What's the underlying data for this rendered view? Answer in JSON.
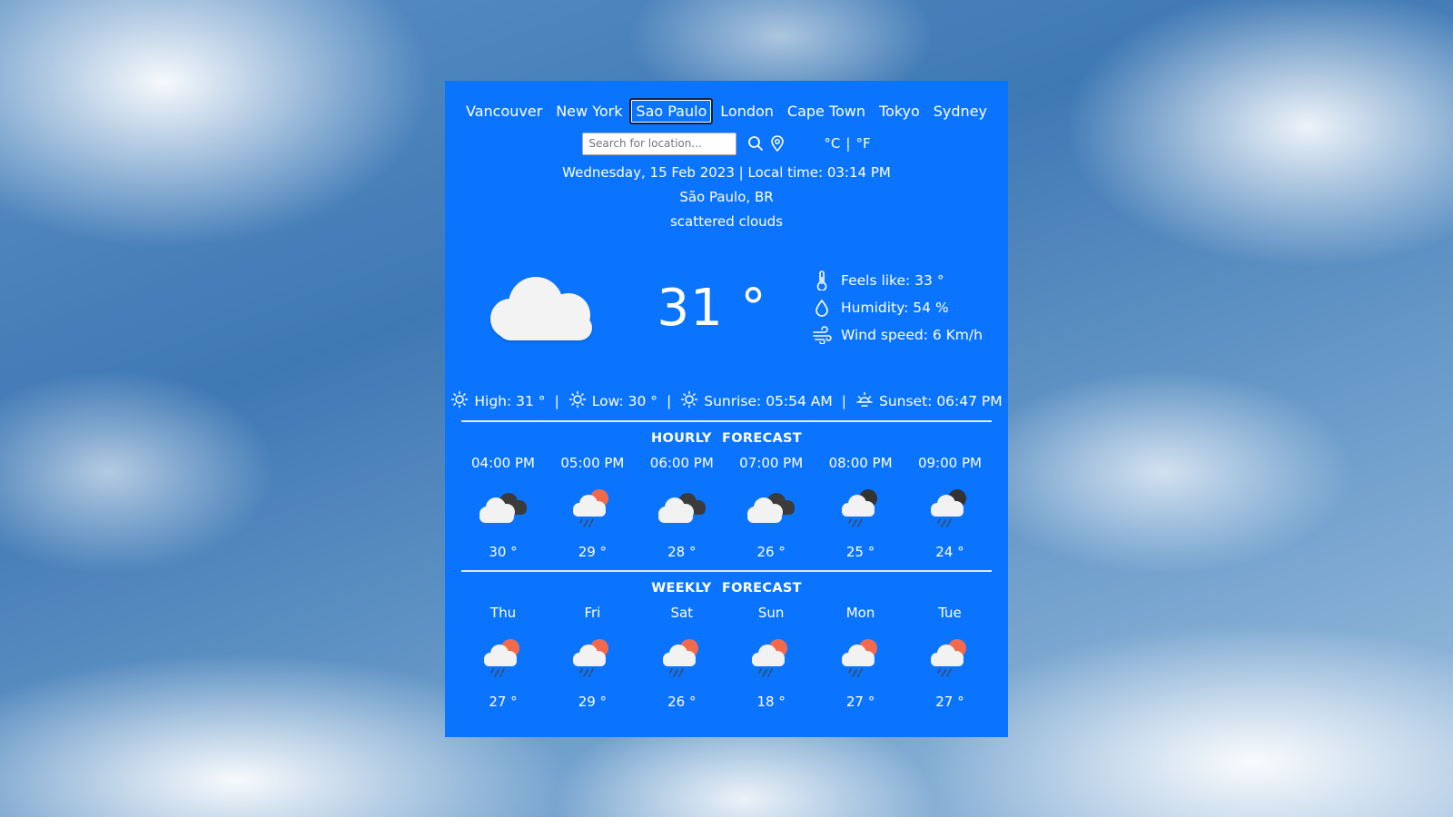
{
  "cities": [
    "Vancouver",
    "New York",
    "Sao Paulo",
    "London",
    "Cape Town",
    "Tokyo",
    "Sydney"
  ],
  "active_city": "Sao Paulo",
  "search": {
    "placeholder": "Search for location..."
  },
  "units": {
    "celsius": "°C",
    "separator": "|",
    "fahrenheit": "°F"
  },
  "current": {
    "date_line": "Wednesday, 15 Feb 2023 | Local time: 03:14 PM",
    "location": "São Paulo, BR",
    "description": "scattered clouds",
    "temperature": "31 °",
    "icon": "cloud-icon",
    "feels_like": "Feels like: 33 °",
    "humidity": "Humidity: 54 %",
    "wind": "Wind speed: 6 Km/h"
  },
  "stats": {
    "high": "High: 31 °",
    "low": "Low: 30 °",
    "sunrise": "Sunrise: 05:54 AM",
    "sunset": "Sunset: 06:47 PM",
    "separator": "|"
  },
  "hourly": {
    "title": "HOURLY FORECAST",
    "items": [
      {
        "label": "04:00 PM",
        "temp": "30 °",
        "icon": "broken-clouds-icon"
      },
      {
        "label": "05:00 PM",
        "temp": "29 °",
        "icon": "sun-rain-icon"
      },
      {
        "label": "06:00 PM",
        "temp": "28 °",
        "icon": "broken-clouds-icon"
      },
      {
        "label": "07:00 PM",
        "temp": "26 °",
        "icon": "broken-clouds-icon"
      },
      {
        "label": "08:00 PM",
        "temp": "25 °",
        "icon": "night-rain-icon"
      },
      {
        "label": "09:00 PM",
        "temp": "24 °",
        "icon": "night-rain-icon"
      }
    ]
  },
  "weekly": {
    "title": "WEEKLY FORECAST",
    "items": [
      {
        "label": "Thu",
        "temp": "27 °",
        "icon": "sun-rain-icon"
      },
      {
        "label": "Fri",
        "temp": "29 °",
        "icon": "sun-rain-icon"
      },
      {
        "label": "Sat",
        "temp": "26 °",
        "icon": "sun-rain-icon"
      },
      {
        "label": "Sun",
        "temp": "18 °",
        "icon": "sun-rain-icon"
      },
      {
        "label": "Mon",
        "temp": "27 °",
        "icon": "sun-rain-icon"
      },
      {
        "label": "Tue",
        "temp": "27 °",
        "icon": "sun-rain-icon"
      }
    ]
  },
  "colors": {
    "card": "#0a74ff",
    "sun": "#f26a4b",
    "moon": "#3a3a3a",
    "rain": "#3d4a5c"
  }
}
